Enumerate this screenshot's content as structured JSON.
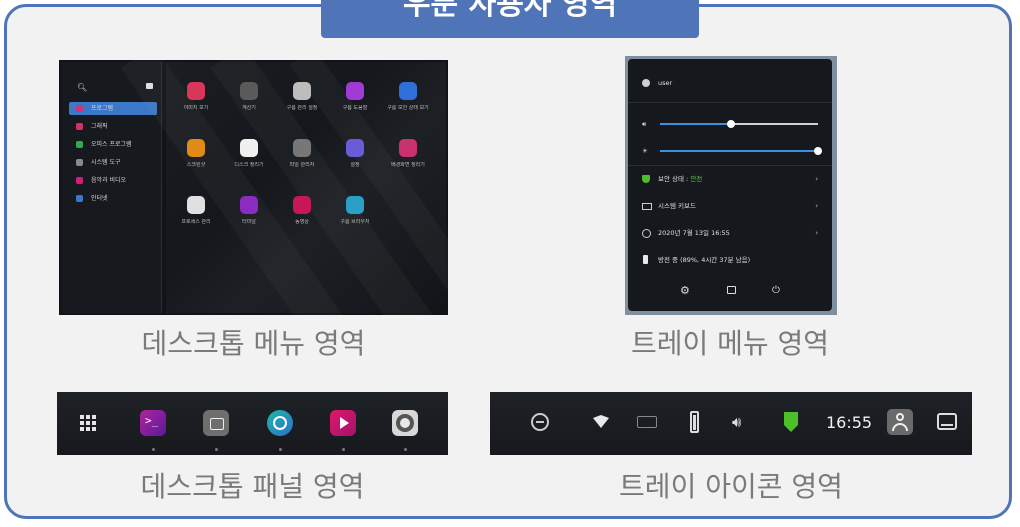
{
  "title": "우분 사용자 영역",
  "captions": {
    "desktop_menu": "데스크톱 메뉴 영역",
    "tray_menu": "트레이 메뉴 영역",
    "desktop_panel": "데스크톱 패널 영역",
    "tray_icons": "트레이 아이콘 영역"
  },
  "desktop_menu": {
    "categories": [
      {
        "label": "프로그램",
        "icon": "apps-icon",
        "color": "#c8357a"
      },
      {
        "label": "그래픽",
        "icon": "graphics-icon",
        "color": "#d0306c"
      },
      {
        "label": "오피스 프로그램",
        "icon": "office-icon",
        "color": "#34a853"
      },
      {
        "label": "시스템 도구",
        "icon": "system-icon",
        "color": "#8a8a8a"
      },
      {
        "label": "음악과 비디오",
        "icon": "media-icon",
        "color": "#d01f7a"
      },
      {
        "label": "인터넷",
        "icon": "internet-icon",
        "color": "#3c78c8"
      }
    ],
    "apps": [
      {
        "label": "이미지 보기",
        "color": "#d8365a"
      },
      {
        "label": "계산기",
        "color": "#5a5a5a"
      },
      {
        "label": "구름 관리 설정",
        "color": "#bdbdbd"
      },
      {
        "label": "구름 도움말",
        "color": "#a13bd6"
      },
      {
        "label": "구름 보안 상태 보기",
        "color": "#2f6fd8"
      },
      {
        "label": "스크린샷",
        "color": "#e08a1a"
      },
      {
        "label": "디스크 정리기",
        "color": "#f0f0f0"
      },
      {
        "label": "파일 관리자",
        "color": "#777777"
      },
      {
        "label": "설정",
        "color": "#6a5cd6"
      },
      {
        "label": "배경화면 정리기",
        "color": "#c9326e"
      },
      {
        "label": "프로세스 관리",
        "color": "#e0e0e0"
      },
      {
        "label": "터미널",
        "color": "#8a2bc2"
      },
      {
        "label": "동영상",
        "color": "#c8165a"
      },
      {
        "label": "구름 브라우저",
        "color": "#2aa0c8"
      }
    ]
  },
  "tray_menu": {
    "user": "user",
    "volume": 0.45,
    "brightness": 1.0,
    "security_label": "보안 상태 : ",
    "security_value": "안전",
    "keyboard": "시스템 키보드",
    "datetime": "2020년 7월 13일    16:55",
    "battery": "방전 중 (89%, 4시간 37분 남음)"
  },
  "panel_icons": [
    "apps-grid-icon",
    "terminal-icon",
    "files-icon",
    "browser-icon",
    "video-icon",
    "settings-icon"
  ],
  "tray": {
    "time": "16:55",
    "icons": [
      "update-icon",
      "wifi-icon",
      "keyboard-icon",
      "battery-icon",
      "volume-icon",
      "shield-icon",
      "user-icon",
      "desktop-icon"
    ]
  }
}
